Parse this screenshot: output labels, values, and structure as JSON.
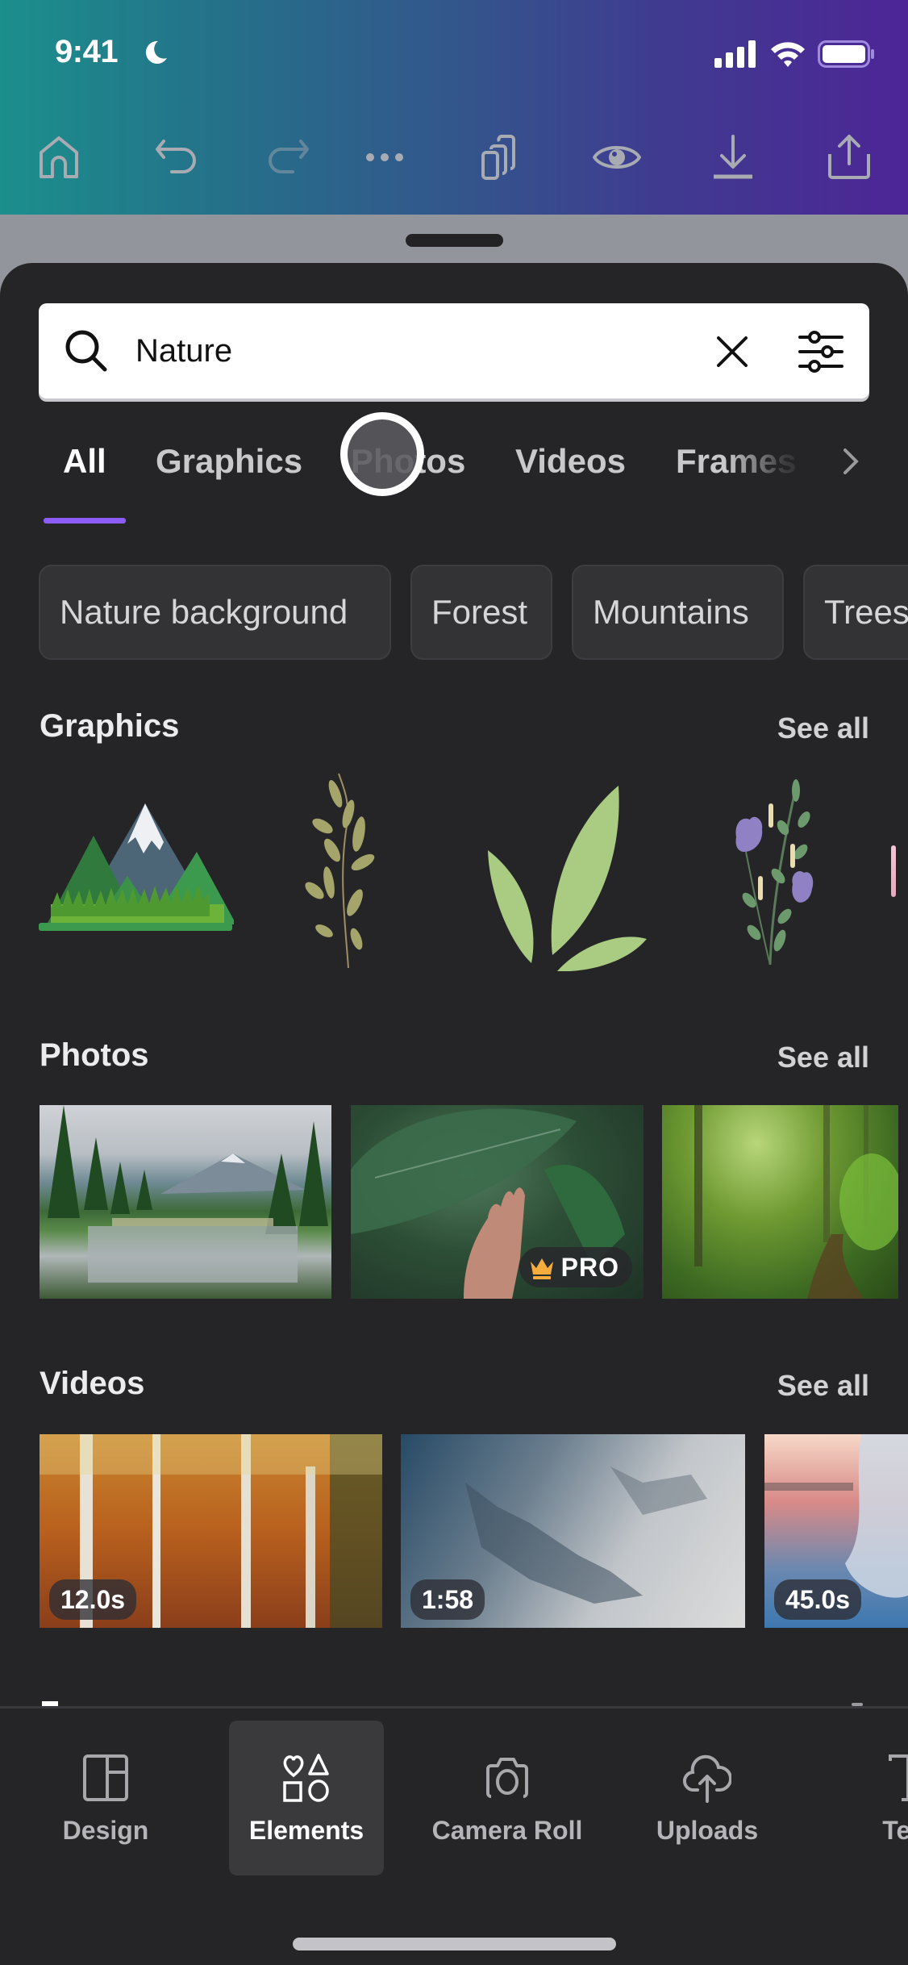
{
  "status_bar": {
    "time": "9:41",
    "icons": [
      "moon-icon",
      "cellular-signal-icon",
      "wifi-icon",
      "battery-icon"
    ]
  },
  "toolbar": {
    "buttons": [
      {
        "name": "home",
        "icon": "home-icon",
        "enabled": true
      },
      {
        "name": "undo",
        "icon": "undo-icon",
        "enabled": true
      },
      {
        "name": "redo",
        "icon": "redo-icon",
        "enabled": false
      },
      {
        "name": "more",
        "icon": "more-icon",
        "enabled": true
      },
      {
        "name": "pages",
        "icon": "pages-icon",
        "enabled": true
      },
      {
        "name": "preview",
        "icon": "eye-icon",
        "enabled": true
      },
      {
        "name": "download",
        "icon": "download-icon",
        "enabled": true
      },
      {
        "name": "share",
        "icon": "share-icon",
        "enabled": true
      }
    ]
  },
  "search": {
    "value": "Nature",
    "icons": [
      "search-icon",
      "clear-icon",
      "filter-icon"
    ]
  },
  "tabs": {
    "items": [
      "All",
      "Graphics",
      "Photos",
      "Videos",
      "Frames"
    ],
    "active": "All",
    "accent_color": "#8d5cf6"
  },
  "chips": [
    "Nature background",
    "Forest",
    "Mountains",
    "Trees"
  ],
  "sections": {
    "graphics": {
      "title": "Graphics",
      "see_all": "See all",
      "items": [
        "mountain-graphic",
        "olive-branch-graphic",
        "green-leaves-graphic",
        "lavender-flowers-graphic"
      ]
    },
    "photos": {
      "title": "Photos",
      "see_all": "See all",
      "items": [
        {
          "subject": "mountain lake with pine trees",
          "pro": false
        },
        {
          "subject": "hand touching green leaf",
          "pro": true,
          "badge": "PRO"
        },
        {
          "subject": "sunlit forest path",
          "pro": false
        }
      ]
    },
    "videos": {
      "title": "Videos",
      "see_all": "See all",
      "items": [
        {
          "subject": "autumn birch forest",
          "duration": "12.0s"
        },
        {
          "subject": "misty pine forest",
          "duration": "1:58"
        },
        {
          "subject": "icy shoreline at sunset",
          "duration": "45.0s"
        }
      ]
    }
  },
  "bottom_nav": {
    "items": [
      {
        "label": "Design",
        "icon": "design-icon"
      },
      {
        "label": "Elements",
        "icon": "elements-icon"
      },
      {
        "label": "Camera Roll",
        "icon": "camera-icon"
      },
      {
        "label": "Uploads",
        "icon": "upload-cloud-icon"
      },
      {
        "label": "Text",
        "icon": "text-icon"
      }
    ],
    "active": "Elements"
  }
}
